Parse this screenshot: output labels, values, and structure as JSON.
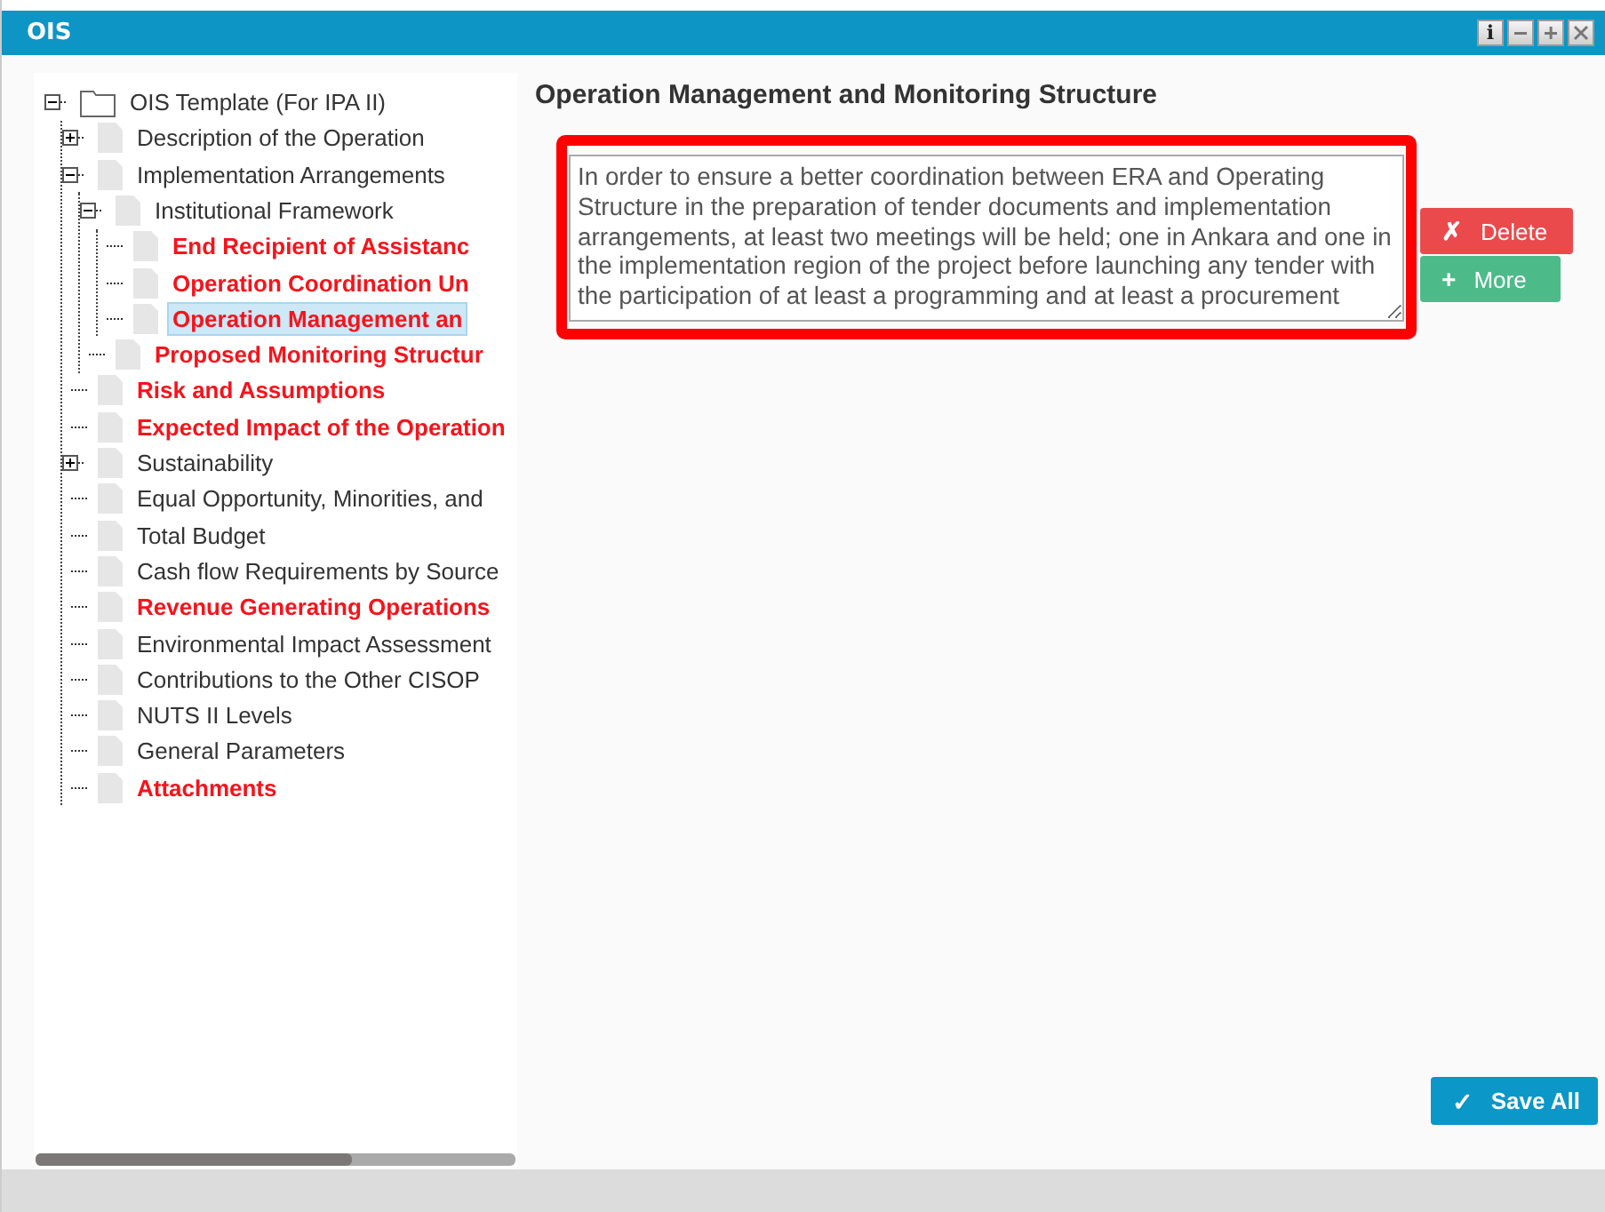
{
  "window": {
    "title": "OIS",
    "controls": [
      {
        "kind": "info",
        "label": "i"
      },
      {
        "kind": "minimize"
      },
      {
        "kind": "maximize"
      },
      {
        "kind": "close"
      }
    ]
  },
  "tree": {
    "root": {
      "label": "OIS Template (For IPA II)",
      "expanded": true,
      "selected": false,
      "required": false,
      "children": [
        {
          "label": "Description of the Operation",
          "expanded": false,
          "selected": false,
          "required": false
        },
        {
          "label": "Implementation Arrangements",
          "expanded": true,
          "selected": false,
          "required": false,
          "children": [
            {
              "label": "Institutional Framework",
              "expanded": true,
              "selected": false,
              "required": false,
              "children": [
                {
                  "label": "End Recipient of Assistanc",
                  "selected": false,
                  "required": true
                },
                {
                  "label": "Operation Coordination Un",
                  "selected": false,
                  "required": true
                },
                {
                  "label": "Operation Management an",
                  "selected": true,
                  "required": true
                }
              ]
            },
            {
              "label": "Proposed Monitoring Structur",
              "selected": false,
              "required": true
            }
          ]
        },
        {
          "label": "Risk and Assumptions",
          "selected": false,
          "required": true
        },
        {
          "label": "Expected Impact of the Operation",
          "selected": false,
          "required": true
        },
        {
          "label": "Sustainability",
          "expanded": false,
          "selected": false,
          "required": false
        },
        {
          "label": "Equal Opportunity, Minorities, and",
          "selected": false,
          "required": false
        },
        {
          "label": "Total Budget",
          "selected": false,
          "required": false
        },
        {
          "label": "Cash flow Requirements by Source",
          "selected": false,
          "required": false
        },
        {
          "label": "Revenue Generating Operations",
          "selected": false,
          "required": true
        },
        {
          "label": "Environmental Impact Assessment",
          "selected": false,
          "required": false
        },
        {
          "label": "Contributions to the Other CISOP",
          "selected": false,
          "required": false
        },
        {
          "label": "NUTS II Levels",
          "selected": false,
          "required": false
        },
        {
          "label": "General Parameters",
          "selected": false,
          "required": false
        },
        {
          "label": "Attachments",
          "selected": false,
          "required": true
        }
      ]
    }
  },
  "editor": {
    "heading": "Operation Management and Monitoring Structure",
    "highlighted": true,
    "value": "In order to ensure a better coordination between ERA and Operating Structure in the preparation of tender documents and implementation arrangements, at least two meetings will be held; one in Ankara and one in the implementation region of the project before launching any tender with the participation of at least a programming and at least a procurement",
    "buttons": [
      {
        "kind": "delete",
        "icon": "✗",
        "label": "Delete"
      },
      {
        "kind": "more",
        "icon": "+",
        "label": "More"
      }
    ]
  },
  "save_button": {
    "icon": "✓",
    "label": "Save All"
  }
}
